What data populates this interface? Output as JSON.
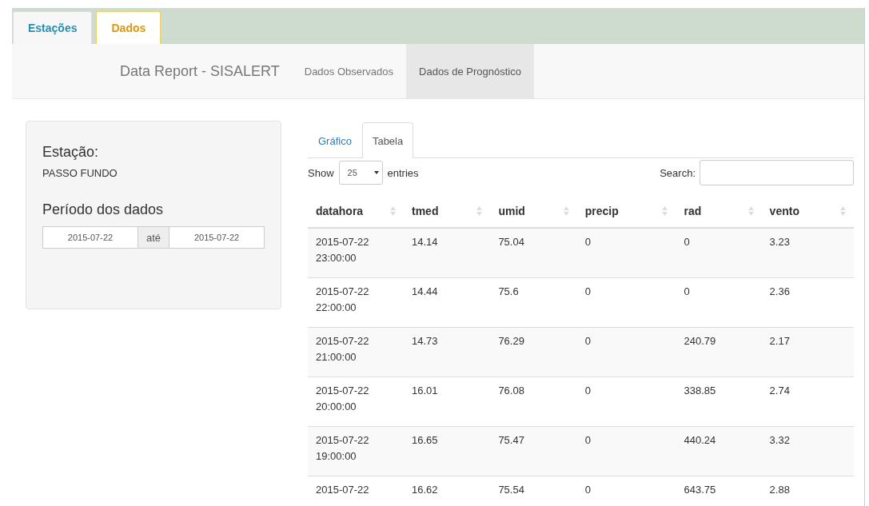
{
  "top_tabs": [
    {
      "label": "Estações",
      "selected": false
    },
    {
      "label": "Dados",
      "selected": true
    }
  ],
  "navbar": {
    "brand": "Data Report - SISALERT",
    "items": [
      {
        "label": "Dados Observados",
        "selected": false
      },
      {
        "label": "Dados de Prognóstico",
        "selected": true
      }
    ]
  },
  "sidebar": {
    "station_label": "Estação:",
    "station": "PASSO FUNDO",
    "period_label": "Período dos dados",
    "date_from": "2015-07-22",
    "separator": "até",
    "date_to": "2015-07-22"
  },
  "view_tabs": [
    {
      "label": "Gráfico",
      "selected": false
    },
    {
      "label": "Tabela",
      "selected": true
    }
  ],
  "table_controls": {
    "show_label": "Show",
    "page_size": "25",
    "entries_label": "entries",
    "search_label": "Search:"
  },
  "table": {
    "columns": [
      "datahora",
      "tmed",
      "umid",
      "precip",
      "rad",
      "vento"
    ],
    "rows": [
      [
        "2015-07-22 23:00:00",
        "14.14",
        "75.04",
        "0",
        "0",
        "3.23"
      ],
      [
        "2015-07-22 22:00:00",
        "14.44",
        "75.6",
        "0",
        "0",
        "2.36"
      ],
      [
        "2015-07-22 21:00:00",
        "14.73",
        "76.29",
        "0",
        "240.79",
        "2.17"
      ],
      [
        "2015-07-22 20:00:00",
        "16.01",
        "76.08",
        "0",
        "338.85",
        "2.74"
      ],
      [
        "2015-07-22 19:00:00",
        "16.65",
        "75.47",
        "0",
        "440.24",
        "3.32"
      ],
      [
        "2015-07-22",
        "16.62",
        "75.54",
        "0",
        "643.75",
        "2.88"
      ]
    ]
  }
}
